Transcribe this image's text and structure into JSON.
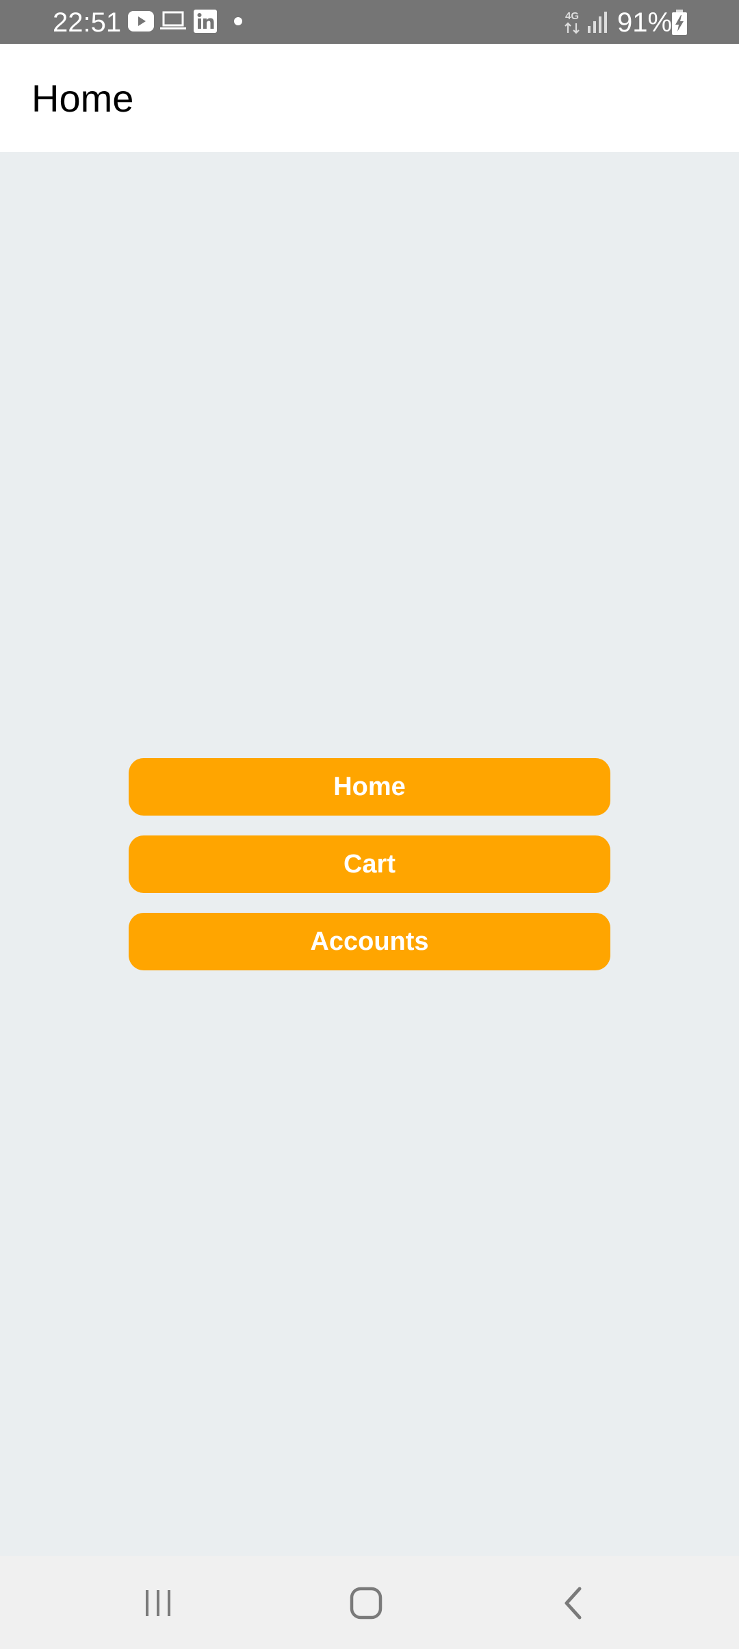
{
  "status_bar": {
    "time": "22:51",
    "battery": "91%",
    "network": "4G",
    "icons": [
      "youtube-icon",
      "laptop-icon",
      "linkedin-icon",
      "notification-dot-icon",
      "network-4g-icon",
      "signal-icon",
      "battery-charging-icon"
    ]
  },
  "app_bar": {
    "title": "Home"
  },
  "buttons": {
    "home": "Home",
    "cart": "Cart",
    "accounts": "Accounts"
  },
  "nav_bar": {
    "icons": [
      "recent-apps-icon",
      "home-icon",
      "back-icon"
    ]
  },
  "colors": {
    "accent": "#ffa500",
    "background": "#eaeef0",
    "status_bar": "#757575"
  }
}
